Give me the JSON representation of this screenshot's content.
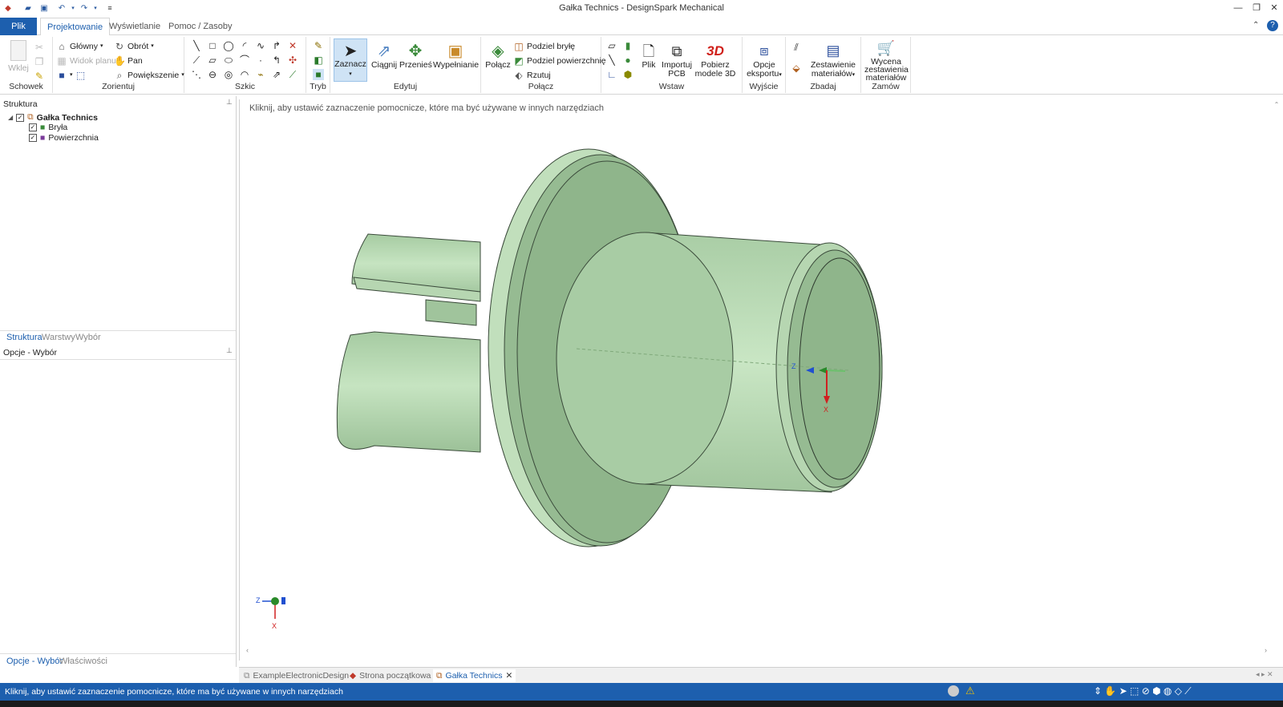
{
  "window": {
    "title": "Gałka Technics - DesignSpark Mechanical"
  },
  "ribbon_tabs": [
    "Plik",
    "Projektowanie",
    "Wyświetlanie",
    "Pomoc / Zasoby"
  ],
  "groups": {
    "schowek": {
      "label": "Schowek",
      "paste": "Wklej"
    },
    "zorientuj": {
      "label": "Zorientuj",
      "home": "Główny",
      "plan": "Widok planu",
      "rotate": "Obrót",
      "pan": "Pan",
      "zoom": "Powiększenie"
    },
    "szkic": {
      "label": "Szkic"
    },
    "tryb": {
      "label": "Tryb"
    },
    "edytuj": {
      "label": "Edytuj",
      "select": "Zaznacz",
      "pull": "Ciągnij",
      "move": "Przenieś",
      "fill": "Wypełnianie"
    },
    "polacz": {
      "label": "Połącz",
      "combine": "Połącz",
      "split_body": "Podziel bryłę",
      "split_face": "Podziel powierzchnię",
      "project": "Rzutuj"
    },
    "wstaw": {
      "label": "Wstaw",
      "file": "Plik",
      "import_pcb_1": "Importuj",
      "import_pcb_2": "PCB",
      "models_1": "Pobierz",
      "models_2": "modele 3D",
      "badge": "3D"
    },
    "wyjscie": {
      "label": "Wyjście",
      "export_1": "Opcje",
      "export_2": "eksportu"
    },
    "zbadaj": {
      "label": "Zbadaj",
      "bom_1": "Zestawienie",
      "bom_2": "materiałów"
    },
    "zamow": {
      "label": "Zamów",
      "quote_1": "Wycena",
      "quote_2": "zestawienia",
      "quote_3": "materiałów"
    }
  },
  "structure": {
    "title": "Struktura",
    "root": "Gałka Technics",
    "items": [
      "Bryła",
      "Powierzchnia"
    ],
    "tabs": [
      "Struktura",
      "Warstwy",
      "Wybór"
    ]
  },
  "options": {
    "title": "Opcje - Wybór",
    "tabs": [
      "Opcje - Wybór",
      "Właściwości"
    ]
  },
  "viewport": {
    "hint": "Kliknij, aby ustawić zaznaczenie pomocnicze, które ma być używane w innych narzędziach",
    "axis_z": "Z",
    "axis_x": "X"
  },
  "doc_tabs": [
    "ExampleElectronicDesign",
    "Strona początkowa",
    "Gałka Technics"
  ],
  "status": {
    "text": "Kliknij, aby ustawić zaznaczenie pomocnicze, które ma być używane w innych narzędziach"
  },
  "colors": {
    "accent": "#1d5fae",
    "model": "#b9d9b3",
    "model_dark": "#8fb58b",
    "edge": "#3a4a3a"
  }
}
